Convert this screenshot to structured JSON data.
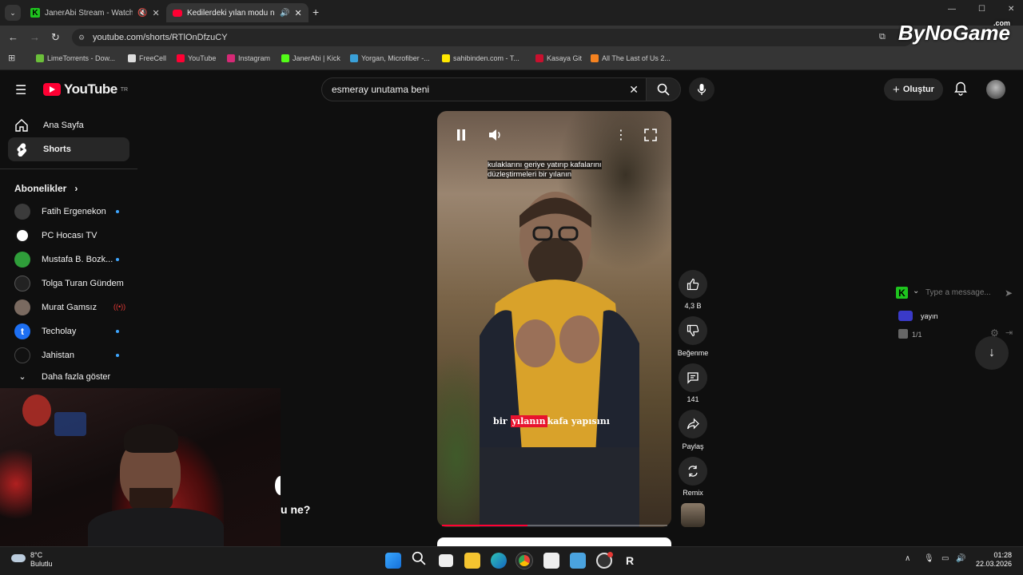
{
  "browser": {
    "tabs": [
      {
        "title": "JanerAbi Stream - Watch Li",
        "active": false
      },
      {
        "title": "Kedilerdeki yılan modu ne?",
        "active": true
      }
    ],
    "url": "youtube.com/shorts/RTlOnDfzuCY",
    "bookmarks": [
      "LimeTorrents - Dow...",
      "FreeCell",
      "YouTube",
      "Instagram",
      "JanerAbi | Kick",
      "Yorgan, Microfiber -...",
      "sahibinden.com - T...",
      "Kasaya Git",
      "All The Last of Us 2..."
    ],
    "watermark": "ByNoGame",
    "watermark_sup": ".com"
  },
  "youtube": {
    "logo": "YouTube",
    "region": "TR",
    "search_value": "esmeray unutama beni",
    "create_label": "Oluştur",
    "nav": [
      {
        "label": "Ana Sayfa",
        "icon": "home-icon"
      },
      {
        "label": "Shorts",
        "icon": "shorts-icon",
        "selected": true
      }
    ],
    "subscriptions_title": "Abonelikler",
    "subscriptions": [
      {
        "name": "Fatih Ergenekon",
        "live": "dot",
        "color": "#3b3b3b"
      },
      {
        "name": "PC Hocası TV",
        "live": "none",
        "color": "#ffffff"
      },
      {
        "name": "Mustafa B. Bozk...",
        "live": "dot",
        "color": "#2f9e3a"
      },
      {
        "name": "Tolga Turan Gündem",
        "live": "none",
        "color": "#222222"
      },
      {
        "name": "Murat Gamsız",
        "live": "live",
        "color": "#7a6a60"
      },
      {
        "name": "Techolay",
        "live": "dot",
        "color": "#1d6ff2"
      },
      {
        "name": "Jahistan",
        "live": "dot",
        "color": "#111111"
      }
    ],
    "show_more": "Daha fazla göster"
  },
  "short": {
    "caption_top": "kulaklarını geriye yatırıp kafalarını düzleştirmeleri bir yılanın",
    "caption_bottom_pre": "bir",
    "caption_bottom_hl": "yılanın",
    "caption_bottom_post": "kafa yapısını",
    "progress": 0.38,
    "actions": {
      "likes": "4,3 B",
      "dislike": "Beğenme",
      "comments": "141",
      "share": "Paylaş",
      "remix": "Remix"
    },
    "cut_title": "u ne?"
  },
  "chat": {
    "placeholder": "Type a message...",
    "user": "yayın",
    "count": "1/1"
  },
  "taskbar": {
    "temp": "8°C",
    "weather": "Bulutlu",
    "time": "01:28",
    "date": "22.03.2026"
  },
  "colors": {
    "accent": "#ff0033",
    "kick": "#53fc18",
    "link": "#3ea6ff"
  }
}
